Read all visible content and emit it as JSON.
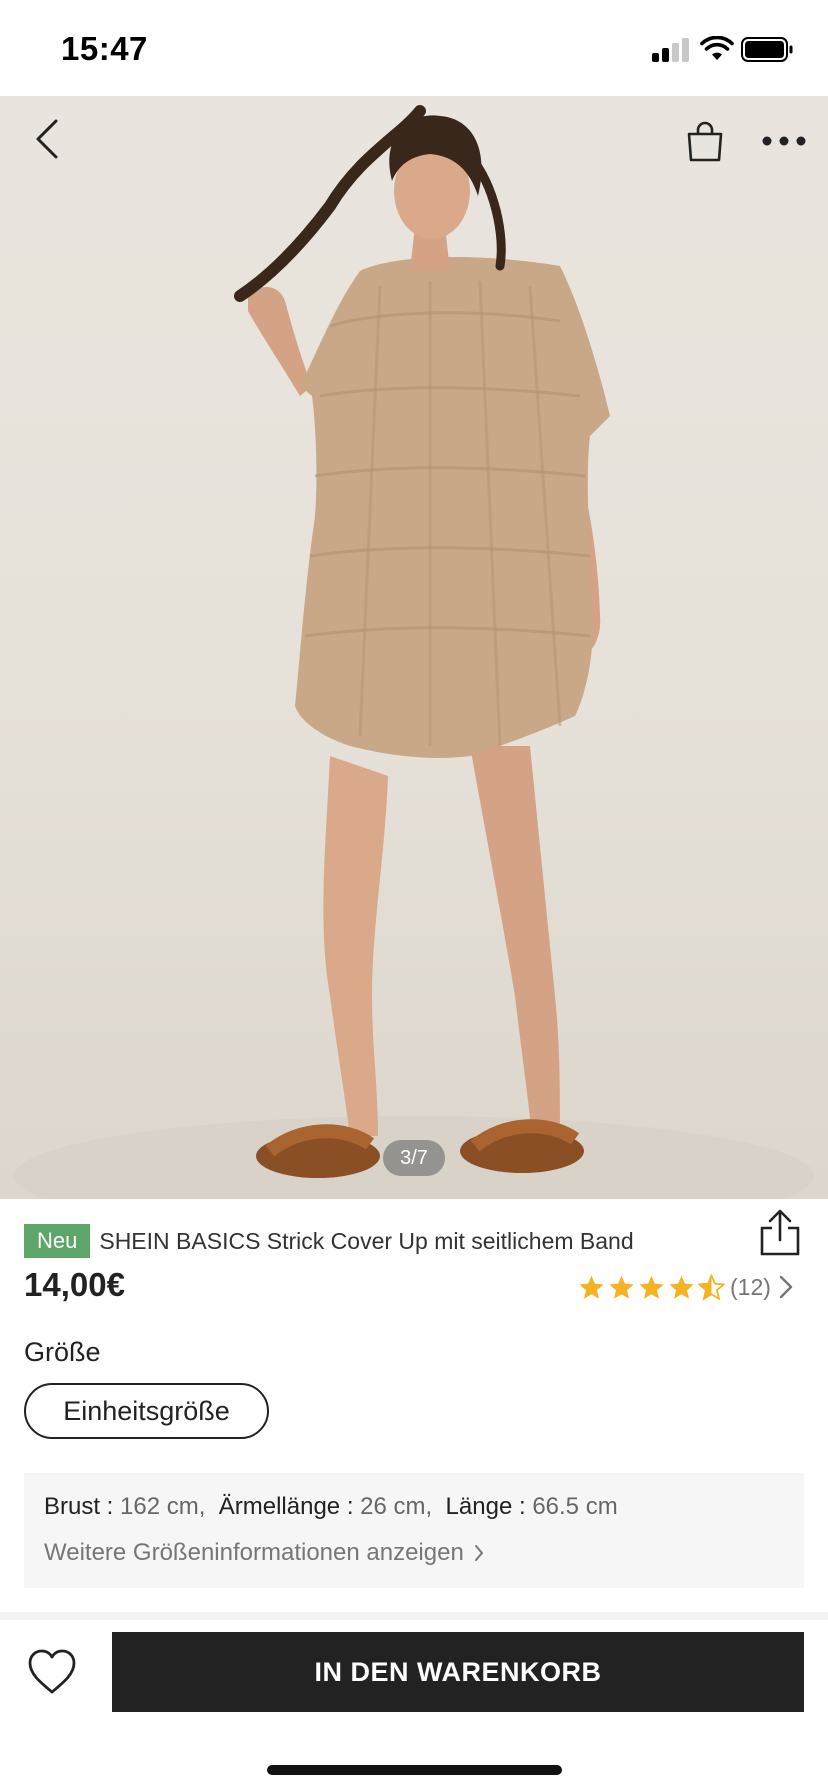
{
  "status_bar": {
    "time": "15:47"
  },
  "gallery": {
    "pager": "3/7",
    "icons": [
      "chevron-left-icon",
      "shopping-bag-icon",
      "more-horizontal-icon"
    ]
  },
  "product": {
    "badge": "Neu",
    "title": "SHEIN BASICS Strick Cover Up mit seitlichem Band",
    "price": "14,00€",
    "rating_value": 4.5,
    "rating_count": "(12)"
  },
  "size": {
    "label": "Größe",
    "selected": "Einheitsgröße"
  },
  "measurements": {
    "items": [
      {
        "key": "Brust",
        "value": "162 cm"
      },
      {
        "key": "Ärmellänge",
        "value": "26 cm"
      },
      {
        "key": "Länge",
        "value": "66.5 cm"
      }
    ],
    "more_link": "Weitere Größeninformationen anzeigen"
  },
  "bottom_bar": {
    "add_to_cart": "IN DEN WARENKORB"
  },
  "colors": {
    "accent_green": "#5ea56a",
    "star_yellow": "#f5b324",
    "button_dark": "#222222"
  }
}
